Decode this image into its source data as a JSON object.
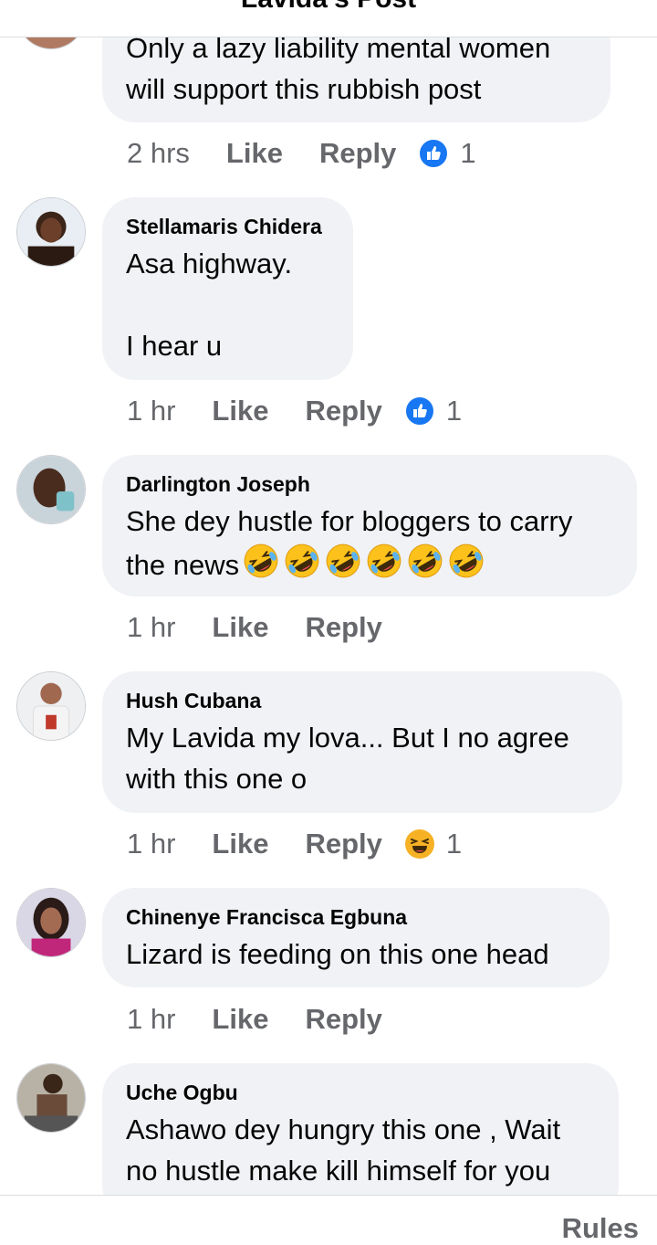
{
  "header": {
    "title": "Lavida's Post"
  },
  "footer": {
    "rules_label": "Rules"
  },
  "comments": [
    {
      "author": "",
      "text": "Only a lazy liability mental women\nwill support this rubbish post",
      "time": "2 hrs",
      "like_label": "Like",
      "reply_label": "Reply",
      "reaction": "like-icon",
      "reaction_count": "1"
    },
    {
      "author": "Stellamaris Chidera",
      "text": "Asa highway.\n\nI hear u",
      "time": "1 hr",
      "like_label": "Like",
      "reply_label": "Reply",
      "reaction": "like-icon",
      "reaction_count": "1"
    },
    {
      "author": "Darlington Joseph",
      "text": "She dey hustle for bloggers to carry\nthe news",
      "emoji": "rolling-on-floor-laughing-icon",
      "emoji_count": 6,
      "time": "1 hr",
      "like_label": "Like",
      "reply_label": "Reply"
    },
    {
      "author": "Hush Cubana",
      "text": "My Lavida my lova... But I no agree\nwith this one o",
      "time": "1 hr",
      "like_label": "Like",
      "reply_label": "Reply",
      "reaction": "haha-icon",
      "reaction_count": "1"
    },
    {
      "author": "Chinenye Francisca Egbuna",
      "text": "Lizard is feeding on this one head",
      "time": "1 hr",
      "like_label": "Like",
      "reply_label": "Reply"
    },
    {
      "author": "Uche Ogbu",
      "text": "Ashawo dey hungry this one , Wait\nno hustle make kill himself for you",
      "time": "",
      "like_label": "",
      "reply_label": ""
    }
  ],
  "colors": {
    "bubble": "#f0f2f5",
    "meta_text": "#65676b",
    "like_blue": "#1877f2",
    "haha_yellow": "#f7b125"
  }
}
